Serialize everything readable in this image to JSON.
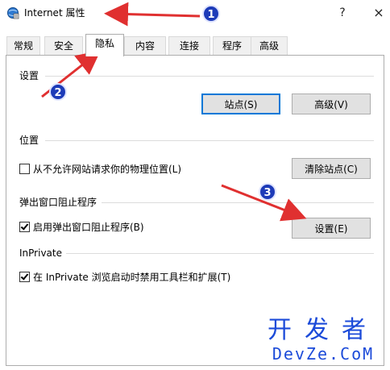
{
  "window": {
    "title": "Internet 属性",
    "help_label": "?",
    "close_label": "×"
  },
  "tabs": [
    {
      "label": "常规"
    },
    {
      "label": "安全"
    },
    {
      "label": "隐私",
      "active": true
    },
    {
      "label": "内容"
    },
    {
      "label": "连接"
    },
    {
      "label": "程序"
    },
    {
      "label": "高级"
    }
  ],
  "settings_section": {
    "label": "设置",
    "sites_button": "站点(S)",
    "advanced_button": "高级(V)"
  },
  "location_section": {
    "label": "位置",
    "checkbox_label": "从不允许网站请求你的物理位置(L)",
    "checked": false,
    "clear_sites_button": "清除站点(C)"
  },
  "popup_section": {
    "label": "弹出窗口阻止程序",
    "checkbox_label": "启用弹出窗口阻止程序(B)",
    "checked": true,
    "settings_button": "设置(E)"
  },
  "inprivate_section": {
    "label": "InPrivate",
    "checkbox_label": "在 InPrivate 浏览启动时禁用工具栏和扩展(T)",
    "checked": true
  },
  "annotations": {
    "badge1": "1",
    "badge2": "2",
    "badge3": "3",
    "arrow_color": "#e03030"
  },
  "watermark": {
    "cn": "开发者",
    "en": "DevZe.CoM"
  }
}
